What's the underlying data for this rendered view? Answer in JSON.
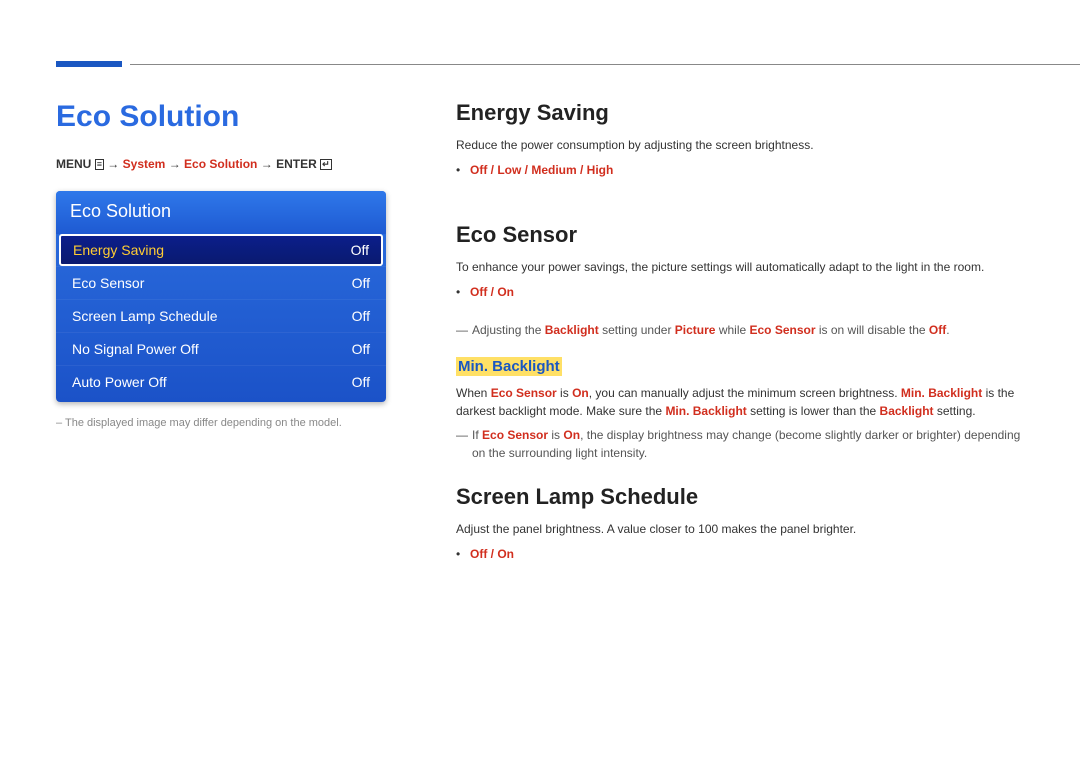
{
  "pageTitle": "Eco Solution",
  "breadcrumb": {
    "menu": "MENU",
    "arrow": "→",
    "parts": [
      "System",
      "Eco Solution"
    ],
    "enter": "ENTER"
  },
  "panel": {
    "header": "Eco Solution",
    "rows": [
      {
        "label": "Energy Saving",
        "value": "Off",
        "selected": true
      },
      {
        "label": "Eco Sensor",
        "value": "Off",
        "selected": false
      },
      {
        "label": "Screen Lamp Schedule",
        "value": "Off",
        "selected": false
      },
      {
        "label": "No Signal Power Off",
        "value": "Off",
        "selected": false
      },
      {
        "label": "Auto Power Off",
        "value": "Off",
        "selected": false
      }
    ],
    "note": "The displayed image may differ depending on the model."
  },
  "sections": {
    "energy": {
      "title": "Energy Saving",
      "desc": "Reduce the power consumption by adjusting the screen brightness.",
      "options": "Off / Low / Medium / High"
    },
    "eco": {
      "title": "Eco Sensor",
      "desc": "To enhance your power savings, the picture settings will automatically adapt to the light in the room.",
      "options": "Off / On",
      "note1_pre": "Adjusting the ",
      "note1_b1": "Backlight",
      "note1_mid1": " setting under ",
      "note1_b2": "Picture",
      "note1_mid2": " while ",
      "note1_b3": "Eco Sensor",
      "note1_mid3": " is on will disable the ",
      "note1_b4": "Off",
      "note1_end": ".",
      "sub": "Min. Backlight",
      "subdesc_pre": "When ",
      "subdesc_b1": "Eco Sensor",
      "subdesc_mid1": " is ",
      "subdesc_b2": "On",
      "subdesc_mid2": ", you can manually adjust the minimum screen brightness. ",
      "subdesc_b3": "Min. Backlight",
      "subdesc_mid3": " is the darkest backlight mode. Make sure the ",
      "subdesc_b4": "Min. Backlight",
      "subdesc_mid4": " setting is lower than the ",
      "subdesc_b5": "Backlight",
      "subdesc_end": " setting.",
      "note2_pre": "If ",
      "note2_b1": "Eco Sensor",
      "note2_mid1": " is ",
      "note2_b2": "On",
      "note2_end": ", the display brightness may change (become slightly darker or brighter) depending on the surrounding light intensity."
    },
    "lamp": {
      "title": "Screen Lamp Schedule",
      "desc": "Adjust the panel brightness. A value closer to 100 makes the panel brighter.",
      "options": "Off / On"
    }
  }
}
